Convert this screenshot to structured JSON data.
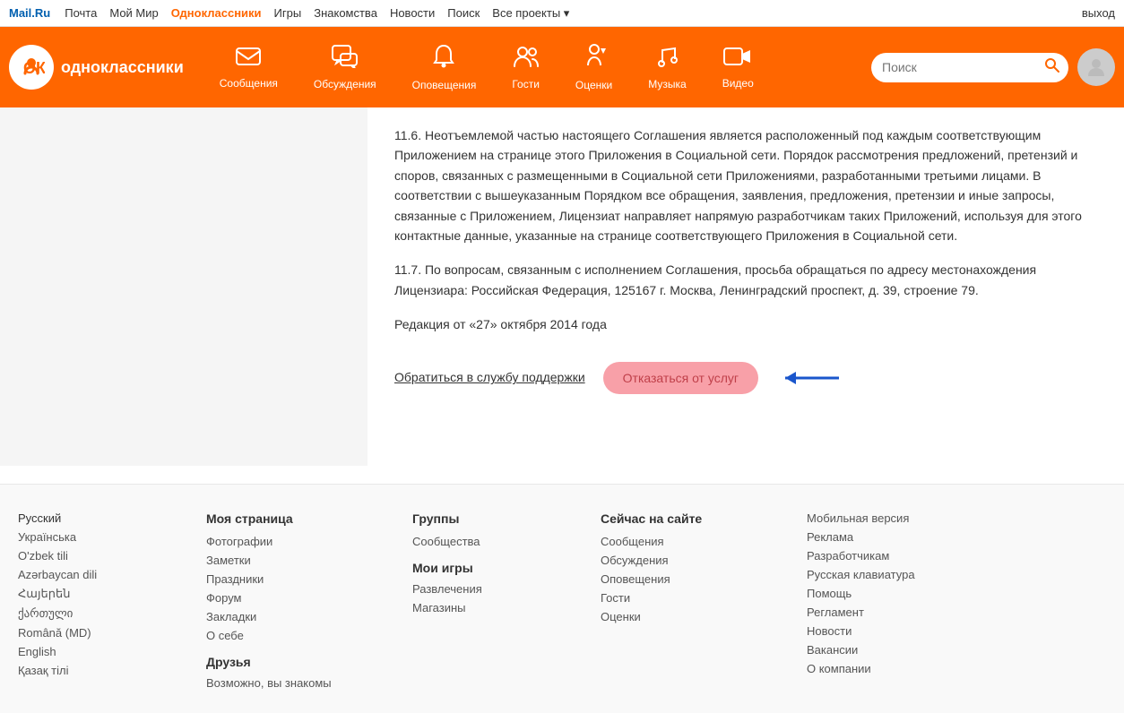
{
  "topnav": {
    "logo": "Mail.Ru",
    "links": [
      {
        "label": "Почта",
        "active": false
      },
      {
        "label": "Мой Мир",
        "active": false
      },
      {
        "label": "Одноклассники",
        "active": true
      },
      {
        "label": "Игры",
        "active": false
      },
      {
        "label": "Знакомства",
        "active": false
      },
      {
        "label": "Новости",
        "active": false
      },
      {
        "label": "Поиск",
        "active": false
      },
      {
        "label": "Все проекты ▾",
        "active": false
      }
    ],
    "logout": "выход"
  },
  "orangenav": {
    "logo_text": "одноклассники",
    "items": [
      {
        "icon": "✉",
        "label": "Сообщения"
      },
      {
        "icon": "💬",
        "label": "Обсуждения"
      },
      {
        "icon": "🔔",
        "label": "Оповещения"
      },
      {
        "icon": "👥",
        "label": "Гости"
      },
      {
        "icon": "🏅",
        "label": "Оценки"
      },
      {
        "icon": "🎵",
        "label": "Музыка"
      },
      {
        "icon": "▶",
        "label": "Видео"
      }
    ],
    "search_placeholder": "Поиск"
  },
  "content": {
    "p1": "11.6. Неотъемлемой частью настоящего Соглашения является расположенный под каждым соответствующим Приложением на странице этого Приложения в Социальной сети. Порядок рассмотрения предложений, претензий и споров, связанных с размещенными в Социальной сети Приложениями, разработанными третьими лицами. В соответствии с вышеуказанным Порядком все обращения, заявления, предложения, претензии и иные запросы, связанные с Приложением, Лицензиат направляет напрямую разработчикам таких Приложений, используя для этого контактные данные, указанные на странице соответствующего Приложения в Социальной сети.",
    "p2": "11.7. По вопросам, связанным с исполнением Соглашения, просьба обращаться по адресу местонахождения Лицензиара: Российская Федерация, 125167 г. Москва, Ленинградский проспект, д. 39, строение 79.",
    "p3": "Редакция от «27» октября 2014 года",
    "support_link": "Обратиться в службу поддержки",
    "cancel_btn": "Отказаться от услуг"
  },
  "footer": {
    "lang_col": {
      "links": [
        "Русский",
        "Українська",
        "O'zbek tili",
        "Azərbaycan dili",
        "Հայերեն",
        "ქართული",
        "Română (MD)",
        "English",
        "Қазақ тілі"
      ]
    },
    "my_page": {
      "title": "Моя страница",
      "links": [
        "Фотографии",
        "Заметки",
        "Праздники",
        "Форум",
        "Закладки",
        "О себе"
      ],
      "friends_title": "Друзья",
      "friends_links": [
        "Возможно, вы знакомы"
      ]
    },
    "groups": {
      "title": "Группы",
      "links": [
        "Сообщества"
      ],
      "games_title": "Мои игры",
      "games_links": [
        "Развлечения",
        "Магазины"
      ]
    },
    "on_site": {
      "title": "Сейчас на сайте",
      "links": [
        "Сообщения",
        "Обсуждения",
        "Оповещения",
        "Гости",
        "Оценки"
      ]
    },
    "misc": {
      "links": [
        "Мобильная версия",
        "Реклама",
        "Разработчикам",
        "Русская клавиатура",
        "Помощь",
        "Регламент",
        "Новости",
        "Вакансии",
        "О компании"
      ]
    }
  }
}
